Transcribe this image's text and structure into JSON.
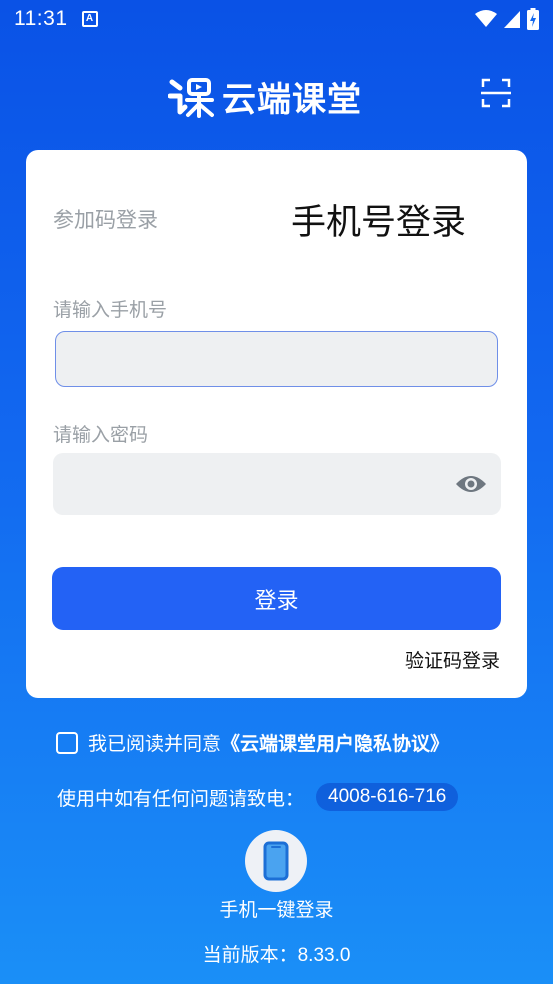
{
  "status_bar": {
    "time": "11:31",
    "notification_icon": "A"
  },
  "header": {
    "app_name": "云端课堂",
    "logo_icon": "cloud-classroom-logo-icon",
    "scan_icon": "scan-icon"
  },
  "login_card": {
    "tab_code_login": "参加码登录",
    "tab_phone_login": "手机号登录",
    "phone_label": "请输入手机号",
    "phone_value": "",
    "password_label": "请输入密码",
    "password_value": "",
    "login_button": "登录",
    "sms_login_link": "验证码登录"
  },
  "agreement": {
    "checked": false,
    "text": "我已阅读并同意",
    "link": "《云端课堂用户隐私协议》"
  },
  "help": {
    "text": "使用中如有任何问题请致电：",
    "phone": "4008-616-716"
  },
  "one_key_login": {
    "label": "手机一键登录",
    "icon": "phone-icon"
  },
  "version": {
    "label": "当前版本：",
    "number": "8.33.0"
  },
  "colors": {
    "primary": "#2362f5",
    "background_top": "#0a52e6",
    "background_bottom": "#1a8ff7"
  }
}
